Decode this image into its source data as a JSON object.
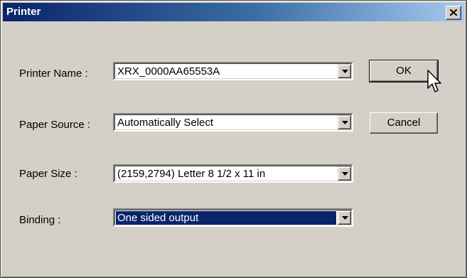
{
  "window": {
    "title": "Printer",
    "close_symbol": "×"
  },
  "fields": {
    "printer_name": {
      "label": "Printer Name :",
      "value": "XRX_0000AA65553A"
    },
    "paper_source": {
      "label": "Paper Source :",
      "value": "Automatically Select"
    },
    "paper_size": {
      "label": "Paper Size :",
      "value": "(2159,2794) Letter 8 1/2 x 11 in"
    },
    "binding": {
      "label": "Binding :",
      "value": "One sided output"
    }
  },
  "buttons": {
    "ok_label": "OK",
    "cancel_label": "Cancel"
  },
  "icons": {
    "close": "close-icon",
    "dropdown": "chevron-down-icon",
    "cursor": "mouse-pointer-icon"
  },
  "colors": {
    "title_gradient_start": "#0a246a",
    "title_gradient_end": "#a6caf0",
    "dialog_face": "#d4d0c8",
    "selection": "#0a246a"
  }
}
